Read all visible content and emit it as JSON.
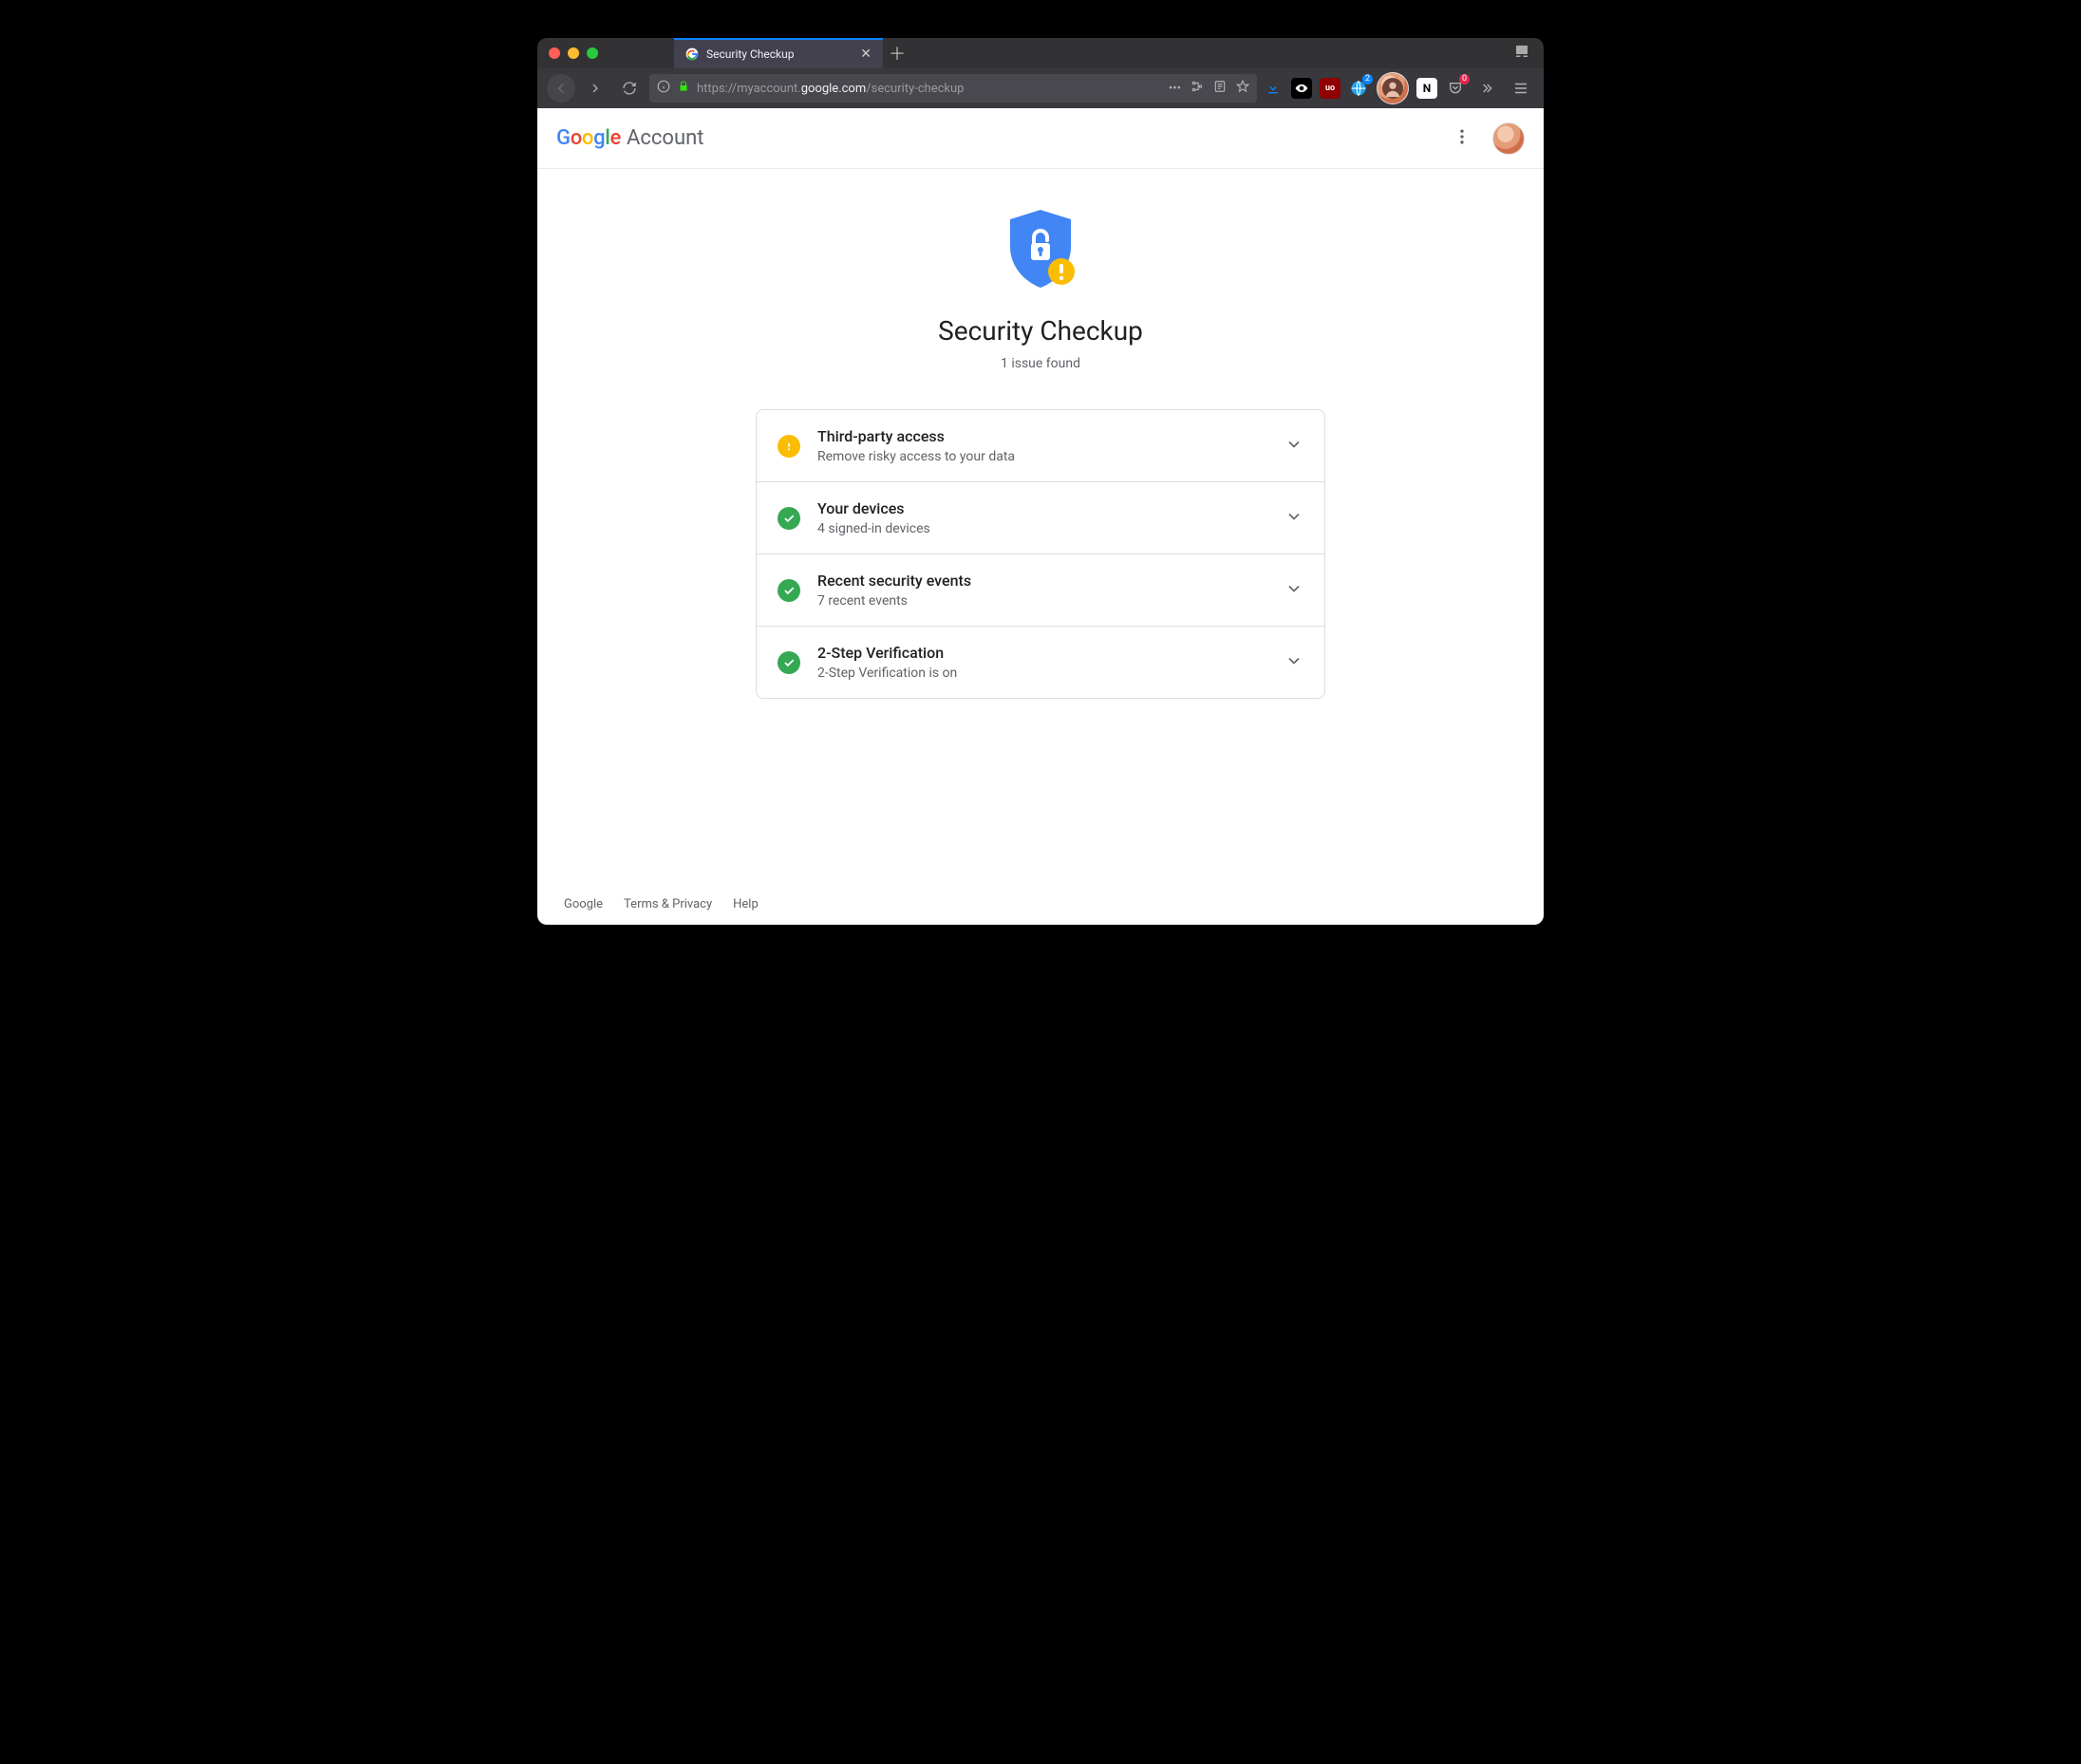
{
  "browser": {
    "tab_title": "Security Checkup",
    "url_display_prefix": "https://myaccount.",
    "url_display_host": "google.com",
    "url_display_suffix": "/security-checkup",
    "ext_badge_globe": "2",
    "ext_badge_red": "0"
  },
  "header": {
    "logo_google": "Google",
    "logo_account": "Account"
  },
  "hero": {
    "title": "Security Checkup",
    "subtitle": "1 issue found"
  },
  "cards": [
    {
      "status": "warn",
      "title": "Third-party access",
      "subtitle": "Remove risky access to your data"
    },
    {
      "status": "ok",
      "title": "Your devices",
      "subtitle": "4 signed-in devices"
    },
    {
      "status": "ok",
      "title": "Recent security events",
      "subtitle": "7 recent events"
    },
    {
      "status": "ok",
      "title": "2-Step Verification",
      "subtitle": "2-Step Verification is on"
    }
  ],
  "footer": {
    "google": "Google",
    "terms": "Terms & Privacy",
    "help": "Help"
  }
}
